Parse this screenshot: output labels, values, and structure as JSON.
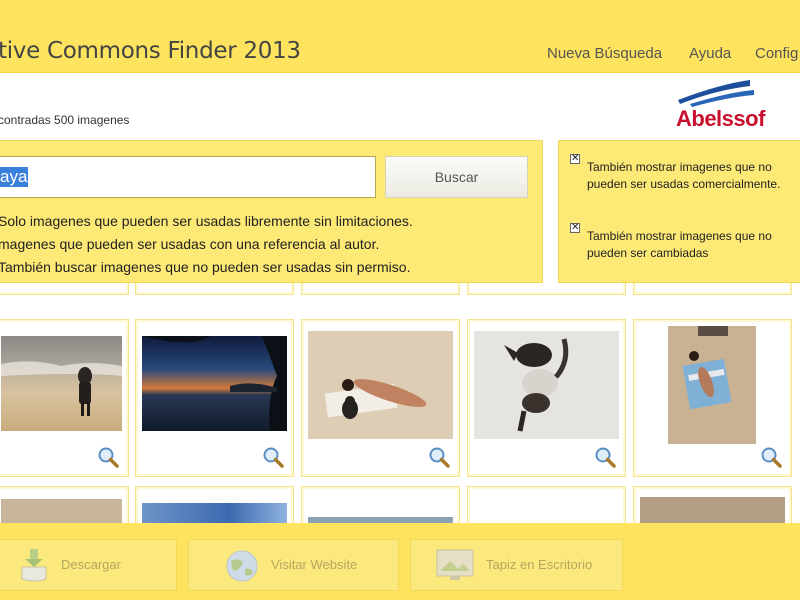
{
  "header": {
    "title": "tive Commons Finder 2013",
    "nav": [
      "Nueva Búsqueda",
      "Ayuda",
      "Config"
    ]
  },
  "results": {
    "count_text": "contradas 500 imagenes"
  },
  "logo": {
    "text": "Abelssof"
  },
  "search": {
    "value": "aya",
    "button_label": "Buscar",
    "options": [
      "Solo imagenes que pueden ser usadas libremente sin limitaciones.",
      "magenes que pueden ser usadas con una referencia al autor.",
      "También buscar imagenes que no pueden ser usadas sin permiso."
    ]
  },
  "filters": {
    "commercial": {
      "label": "También mostrar imagenes que no pueden ser usadas comercialmente.",
      "checked": true
    },
    "modified": {
      "label": "También mostrar imagenes que no pueden ser cambiadas",
      "checked": true
    }
  },
  "toolbar": {
    "download_label": "Descargar",
    "website_label": "Visitar Website",
    "wallpaper_label": "Tapiz en Escritorio"
  },
  "colors": {
    "header": "#fde35e",
    "panel": "#fde976",
    "accent": "#3b80d8",
    "brand": "#c8102e"
  },
  "icons": [
    "zoom-icon",
    "download-icon",
    "globe-icon",
    "wallpaper-icon",
    "checkbox-checked-icon"
  ]
}
